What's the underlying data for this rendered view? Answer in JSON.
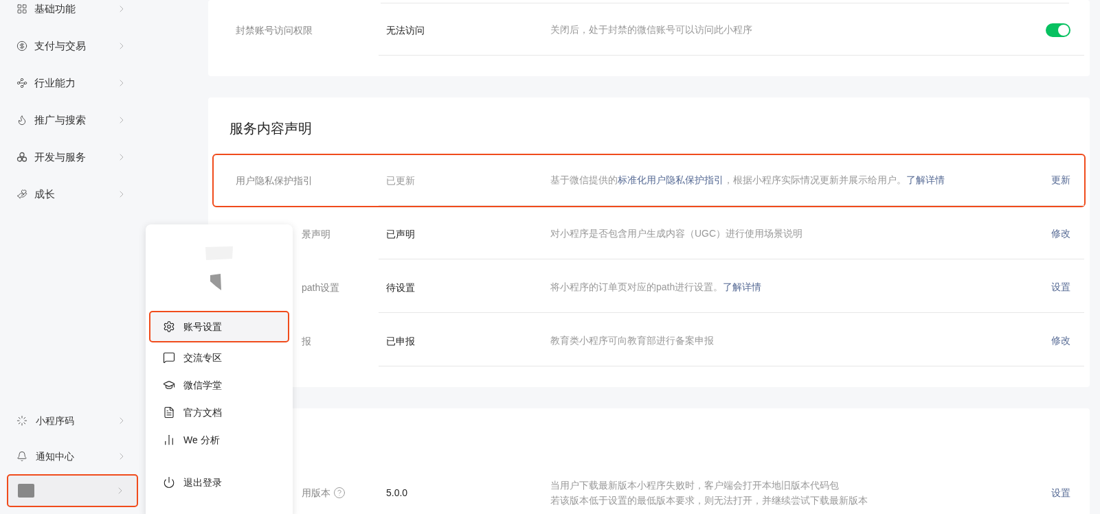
{
  "sidebar": {
    "items": [
      {
        "label": "基础功能"
      },
      {
        "label": "支付与交易"
      },
      {
        "label": "行业能力"
      },
      {
        "label": "推广与搜索"
      },
      {
        "label": "开发与服务"
      },
      {
        "label": "成长"
      }
    ],
    "bottom_items": [
      {
        "label": "小程序码"
      },
      {
        "label": "通知中心"
      }
    ],
    "account": {
      "highlighted": true
    }
  },
  "cards": [
    {
      "rows": [
        {
          "kind": "covered_none",
          "label": "封禁账号访问权限",
          "value": "无法访问",
          "value_muted": false,
          "highlighted": false,
          "description": [
            {
              "text": "关闭后，处于封禁的微信账号可以访问此小程序",
              "link": false
            }
          ],
          "action": {
            "kind": "toggle",
            "on": true
          }
        }
      ]
    },
    {
      "title": "服务内容声明",
      "rows": [
        {
          "kind": "plain",
          "label": "用户隐私保护指引",
          "value": "已更新",
          "value_muted": true,
          "highlighted": true,
          "description": [
            {
              "text": "基于微信提供的",
              "link": false
            },
            {
              "text": "标准化用户隐私保护指引",
              "link": true
            },
            {
              "text": "，根据小程序实际情况更新并展示给用户。",
              "link": false
            },
            {
              "text": "了解详情",
              "link": true
            }
          ],
          "action": {
            "kind": "link",
            "label": "更新"
          }
        },
        {
          "kind": "covered",
          "label": "景声明",
          "value": "已声明",
          "value_muted": false,
          "highlighted": false,
          "description": [
            {
              "text": "对小程序是否包含用户生成内容（UGC）进行使用场景说明",
              "link": false
            }
          ],
          "action": {
            "kind": "link",
            "label": "修改"
          }
        },
        {
          "kind": "covered",
          "label": "path设置",
          "value": "待设置",
          "value_muted": false,
          "highlighted": false,
          "description": [
            {
              "text": "将小程序的订单页对应的path进行设置。",
              "link": false
            },
            {
              "text": "了解详情",
              "link": true
            }
          ],
          "action": {
            "kind": "link",
            "label": "设置"
          }
        },
        {
          "kind": "covered",
          "label": "报",
          "value": "已申报",
          "value_muted": false,
          "highlighted": false,
          "description": [
            {
              "text": "教育类小程序可向教育部进行备案申报",
              "link": false
            }
          ],
          "action": {
            "kind": "link",
            "label": "修改"
          }
        }
      ]
    },
    {
      "rows": [
        {
          "kind": "covered",
          "label": "用版本",
          "help": true,
          "value": "5.0.0",
          "value_muted": false,
          "highlighted": false,
          "description_lines": [
            "当用户下载最新版本小程序失败时，客户端会打开本地旧版本代码包",
            "若该版本低于设置的最低版本要求，则无法打开，并继续尝试下载最新版本"
          ],
          "action": {
            "kind": "link",
            "label": "设置"
          }
        }
      ]
    }
  ],
  "popup_menu": {
    "items": [
      {
        "label": "账号设置",
        "highlighted": true
      },
      {
        "label": "交流专区",
        "highlighted": false
      },
      {
        "label": "微信学堂",
        "highlighted": false
      },
      {
        "label": "官方文档",
        "highlighted": false
      },
      {
        "label": "We 分析",
        "highlighted": false
      }
    ],
    "logout": {
      "label": "退出登录"
    }
  }
}
